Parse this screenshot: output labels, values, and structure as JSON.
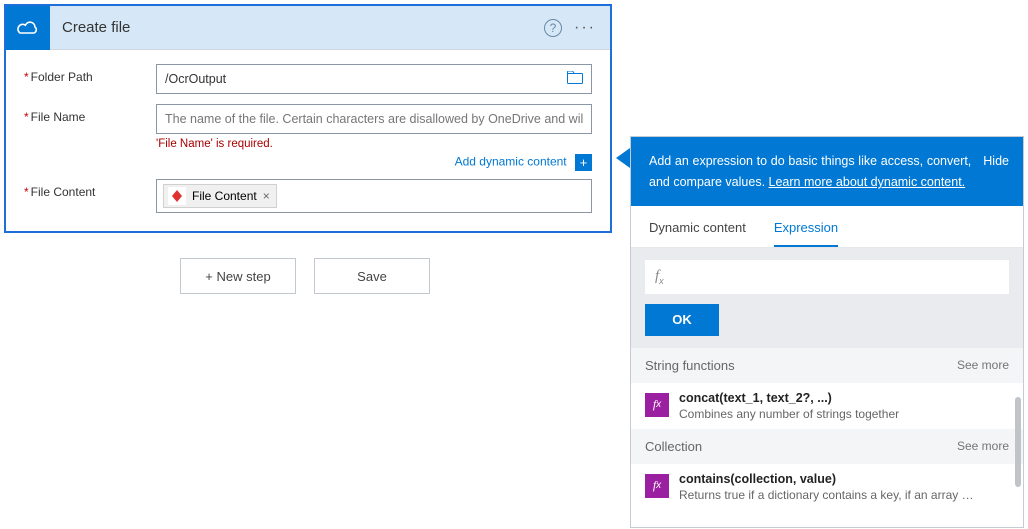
{
  "card": {
    "title": "Create file",
    "folder_label": "Folder Path",
    "folder_value": "/OcrOutput",
    "file_label": "File Name",
    "file_placeholder": "The name of the file. Certain characters are disallowed by OneDrive and will be",
    "file_error": "'File Name' is required.",
    "dyn_link": "Add dynamic content",
    "content_label": "File Content",
    "content_token": "File Content"
  },
  "actions": {
    "new_step": "+ New step",
    "save": "Save"
  },
  "panel": {
    "intro_a": "Add an expression to do basic things like access, convert, and compare values. ",
    "intro_link": "Learn more about dynamic content.",
    "hide": "Hide",
    "tabs": {
      "dyn": "Dynamic content",
      "expr": "Expression"
    },
    "ok": "OK",
    "sections": {
      "string": {
        "title": "String functions",
        "see": "See more",
        "fn_title": "concat(text_1, text_2?, ...)",
        "fn_desc": "Combines any number of strings together"
      },
      "collection": {
        "title": "Collection",
        "see": "See more",
        "fn_title": "contains(collection, value)",
        "fn_desc": "Returns true if a dictionary contains a key, if an array cont..."
      }
    }
  },
  "icons": {
    "cloud": "cloud-icon",
    "help": "help-icon",
    "more": "more-icon",
    "folder": "folder-icon",
    "plus": "plus-icon",
    "fx": "fx-icon"
  }
}
